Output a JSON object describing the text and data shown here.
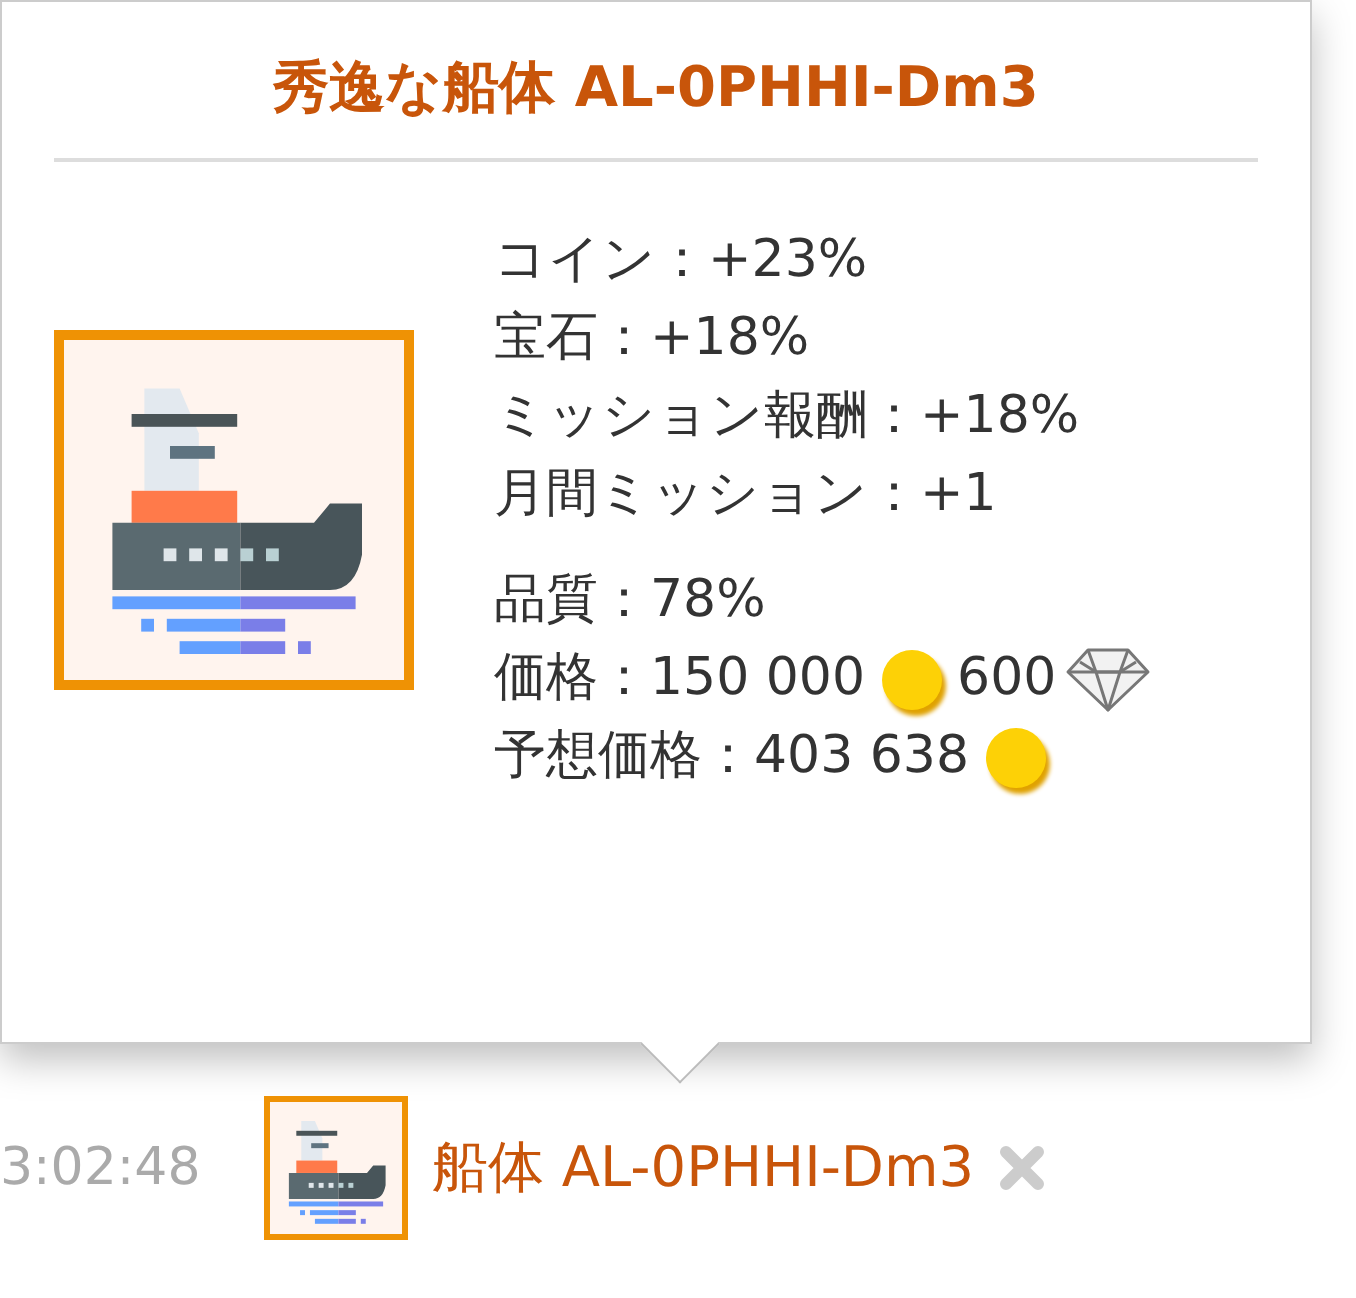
{
  "tooltip": {
    "title": "秀逸な船体 AL-0PHHI-Dm3",
    "stat_groups": [
      [
        {
          "parts": [
            {
              "kind": "text",
              "text": "コイン：+23%"
            }
          ]
        },
        {
          "parts": [
            {
              "kind": "text",
              "text": "宝石：+18%"
            }
          ]
        },
        {
          "parts": [
            {
              "kind": "text",
              "text": "ミッション報酬：+18%"
            }
          ]
        },
        {
          "parts": [
            {
              "kind": "text",
              "text": "月間ミッション：+1"
            }
          ]
        }
      ],
      [
        {
          "parts": [
            {
              "kind": "text",
              "text": "品質：78%"
            }
          ]
        },
        {
          "parts": [
            {
              "kind": "text",
              "text": "価格：150 000"
            },
            {
              "kind": "coin"
            },
            {
              "kind": "text",
              "text": "600"
            },
            {
              "kind": "gem"
            }
          ]
        },
        {
          "parts": [
            {
              "kind": "text",
              "text": "予想価格：403 638"
            },
            {
              "kind": "coin"
            }
          ]
        }
      ]
    ]
  },
  "log_entry": {
    "time": "3:02:48",
    "name": "船体 AL-0PHHI-Dm3"
  }
}
